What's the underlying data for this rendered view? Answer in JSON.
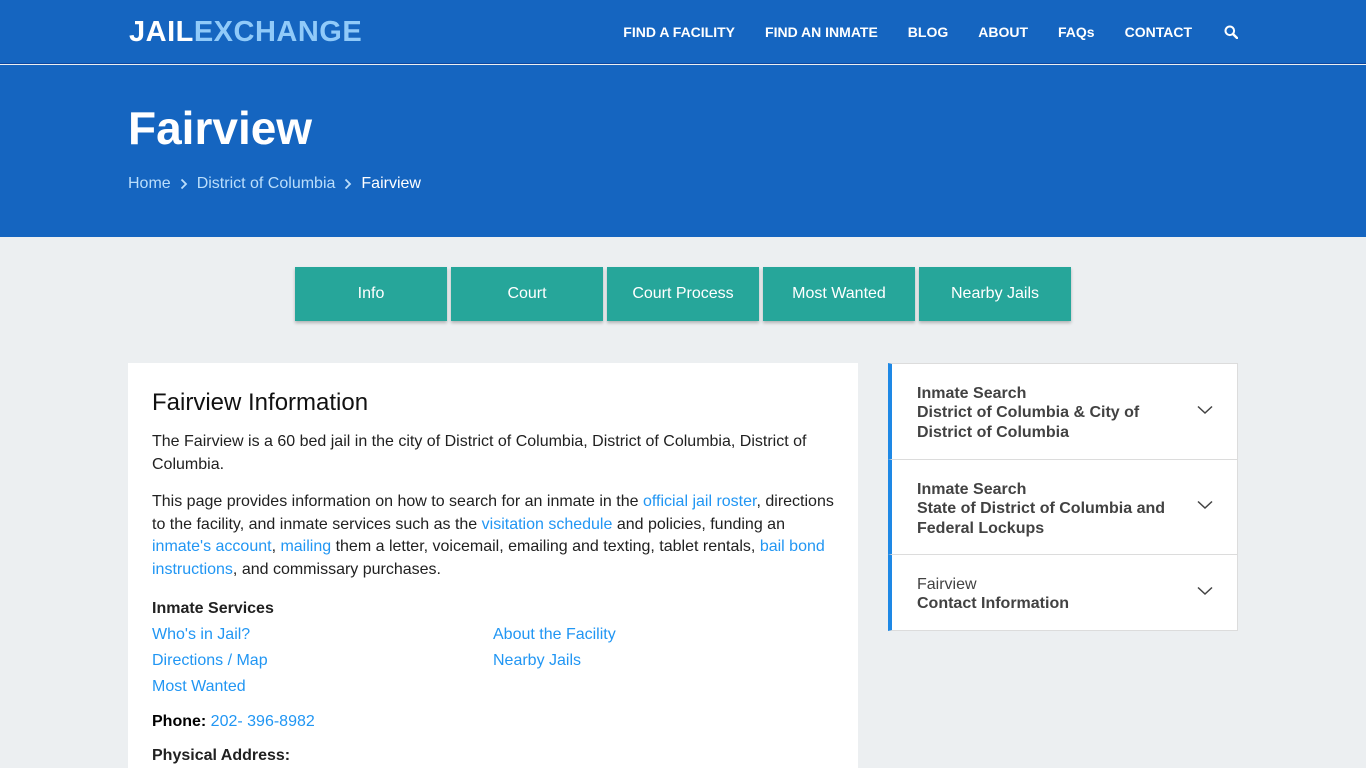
{
  "header": {
    "logo_part1": "JAIL",
    "logo_part2": "EXCHANGE",
    "nav": [
      "FIND A FACILITY",
      "FIND AN INMATE",
      "BLOG",
      "ABOUT",
      "FAQs",
      "CONTACT"
    ],
    "search_icon": "search-icon"
  },
  "hero": {
    "title": "Fairview",
    "breadcrumb": [
      "Home",
      "District of Columbia",
      "Fairview"
    ]
  },
  "tabs": [
    "Info",
    "Court",
    "Court Process",
    "Most Wanted",
    "Nearby Jails"
  ],
  "main": {
    "heading": "Fairview Information",
    "p1": "The Fairview is a 60 bed jail in the city of District of Columbia, District of Columbia, District of Columbia.",
    "p2": {
      "t1": "This page provides information on how to search for an inmate in the ",
      "l1": "official jail roster",
      "t2": ", directions to the facility, and inmate services such as the ",
      "l2": "visitation schedule",
      "t3": " and policies, funding an ",
      "l3": "inmate's account",
      "t4": ", ",
      "l4": "mailing",
      "t5": " them a letter, voicemail, emailing and texting, tablet rentals, ",
      "l5": "bail bond instructions",
      "t6": ", and commissary purchases."
    },
    "services_title": "Inmate Services",
    "services": [
      "Who's in Jail?",
      "About the Facility",
      "Directions / Map",
      "Nearby Jails",
      "Most Wanted"
    ],
    "phone_label": "Phone:",
    "phone": "202- 396-8982",
    "address_label": "Physical Address:"
  },
  "sidebar": [
    {
      "line1": "Inmate Search",
      "line2": "District of Columbia & City of District of Columbia"
    },
    {
      "line1": "Inmate Search",
      "line2": "State of District of Columbia and Federal Lockups"
    },
    {
      "line1": "Fairview",
      "line2": "Contact Information"
    }
  ],
  "colors": {
    "primary": "#1565c0",
    "tab": "#26a69a",
    "link": "#2196f3",
    "accent_border": "#1e88e5"
  }
}
